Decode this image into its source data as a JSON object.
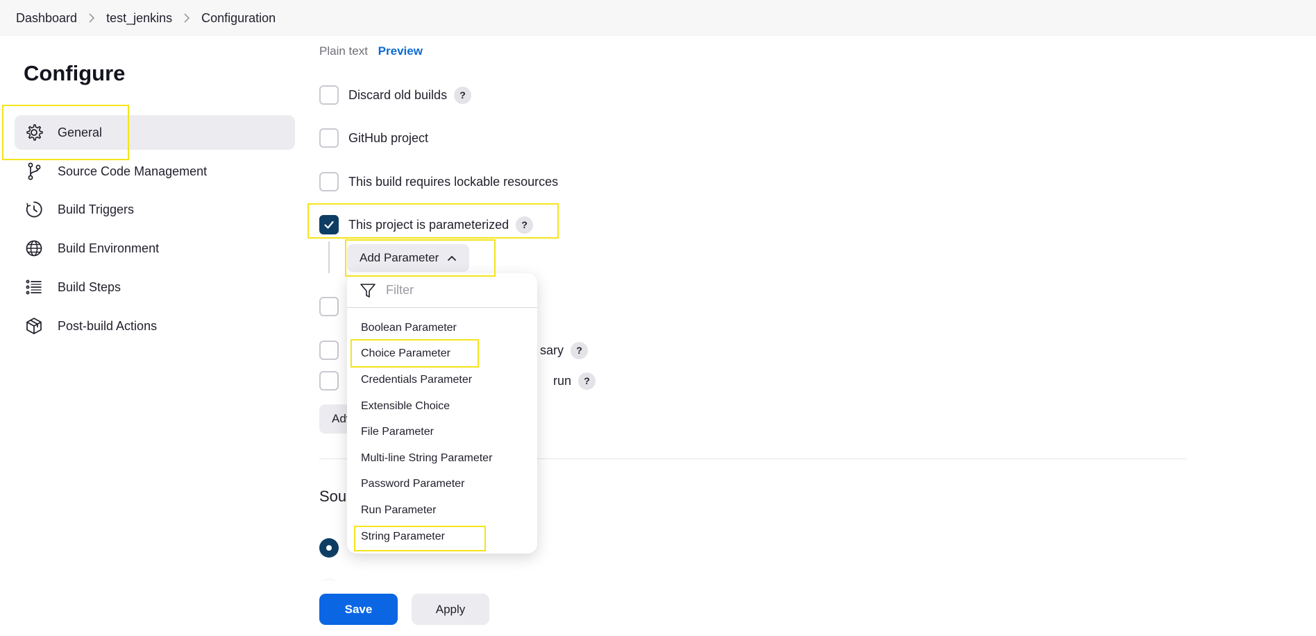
{
  "breadcrumb": {
    "items": [
      "Dashboard",
      "test_jenkins",
      "Configuration"
    ]
  },
  "sidebar": {
    "title": "Configure",
    "items": [
      {
        "label": "General",
        "icon": "gear-icon"
      },
      {
        "label": "Source Code Management",
        "icon": "branch-icon"
      },
      {
        "label": "Build Triggers",
        "icon": "clock-icon"
      },
      {
        "label": "Build Environment",
        "icon": "globe-icon"
      },
      {
        "label": "Build Steps",
        "icon": "list-icon"
      },
      {
        "label": "Post-build Actions",
        "icon": "package-icon"
      }
    ]
  },
  "description": {
    "plain_text": "Plain text",
    "preview": "Preview"
  },
  "options": [
    {
      "label": "Discard old builds",
      "checked": false,
      "help": "?"
    },
    {
      "label": "GitHub project",
      "checked": false
    },
    {
      "label": "This build requires lockable resources",
      "checked": false
    },
    {
      "label": "This project is parameterized",
      "checked": true,
      "help": "?"
    },
    {
      "label": "",
      "checked": false
    },
    {
      "label": "sary",
      "checked": false,
      "help": "?"
    },
    {
      "label": "run",
      "checked": false,
      "help": "?"
    }
  ],
  "add_parameter": {
    "label": "Add Parameter",
    "filter_placeholder": "Filter",
    "items": [
      "Boolean Parameter",
      "Choice Parameter",
      "Credentials Parameter",
      "Extensible Choice",
      "File Parameter",
      "Multi-line String Parameter",
      "Password Parameter",
      "Run Parameter",
      "String Parameter"
    ]
  },
  "advanced_label": "Adv",
  "section_heading": "Sou",
  "actions": {
    "save": "Save",
    "apply": "Apply"
  },
  "colors": {
    "accent_blue": "#0b66e4",
    "checkbox_checked": "#0e3d63",
    "highlight": "#f5e41a",
    "link": "#0b6bd3"
  }
}
